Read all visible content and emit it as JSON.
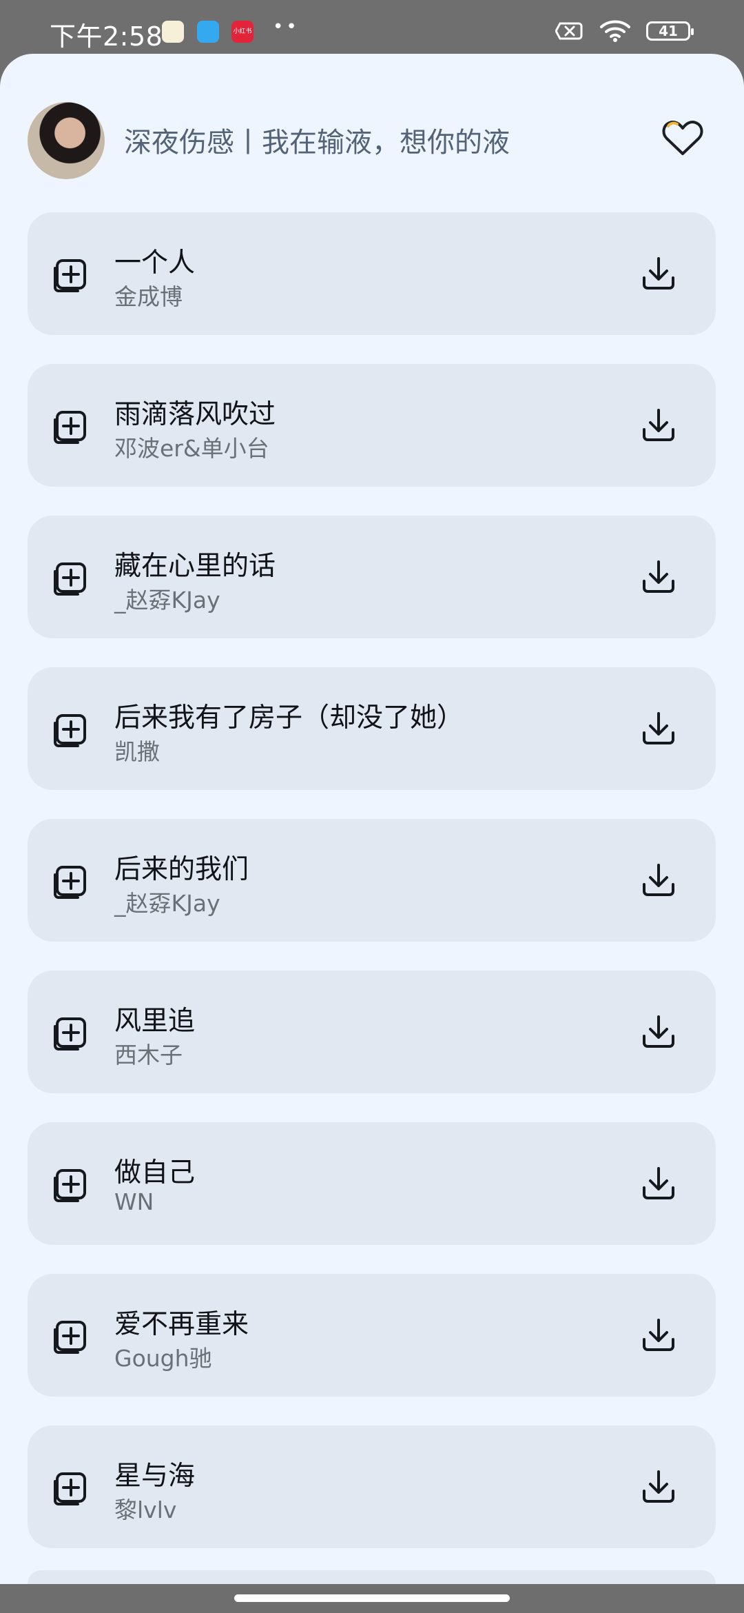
{
  "status_bar": {
    "time": "下午2:58",
    "app_c_label": "小红书",
    "dots": "••",
    "battery_level": "41",
    "icons": [
      "clock-icon",
      "app-icon",
      "xiaohongshu-icon",
      "signal-off-icon",
      "wifi-icon",
      "battery-icon"
    ]
  },
  "playlist": {
    "title": "深夜伤感丨我在输液，想你的液",
    "favorite_icon": "heart-icon"
  },
  "songs": [
    {
      "title": "一个人",
      "artist": "金成博"
    },
    {
      "title": "雨滴落风吹过",
      "artist": "邓波er&单小台"
    },
    {
      "title": "藏在心里的话",
      "artist": "_赵孬KJay"
    },
    {
      "title": "后来我有了房子（却没了她）",
      "artist": "凯撒"
    },
    {
      "title": "后来的我们",
      "artist": "_赵孬KJay"
    },
    {
      "title": "风里追",
      "artist": "西木子"
    },
    {
      "title": "做自己",
      "artist": "WN"
    },
    {
      "title": "爱不再重来",
      "artist": "Gough驰"
    },
    {
      "title": "星与海",
      "artist": "黎lvlv"
    }
  ],
  "icons": {
    "add": "add-to-playlist-icon",
    "download": "download-icon"
  },
  "colors": {
    "sheet_background": "#eef5fe",
    "card_background": "#e2e8f1",
    "title_text": "#101317",
    "artist_text": "#6a7078",
    "heart_accent": "#f0b43b"
  }
}
